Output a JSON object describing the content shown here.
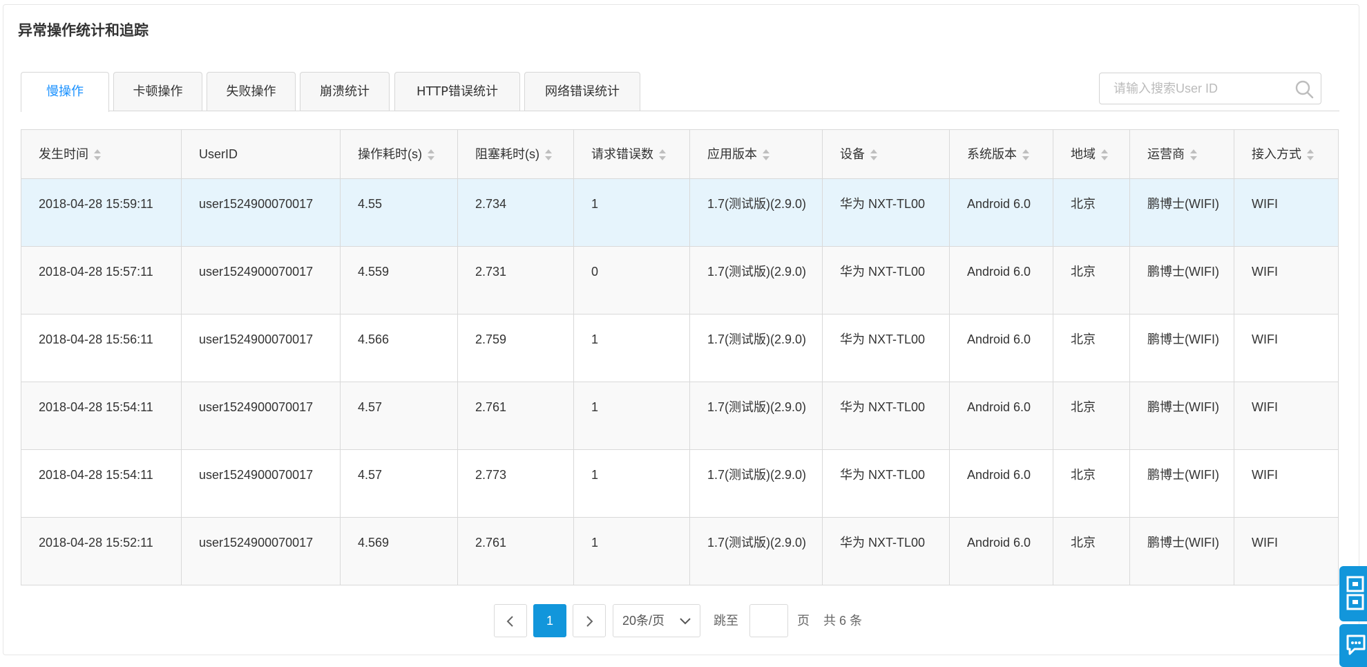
{
  "page": {
    "title": "异常操作统计和追踪"
  },
  "tabs": [
    {
      "label": "慢操作",
      "active": true
    },
    {
      "label": "卡顿操作",
      "active": false
    },
    {
      "label": "失败操作",
      "active": false
    },
    {
      "label": "崩溃统计",
      "active": false
    },
    {
      "label": "HTTP错误统计",
      "active": false
    },
    {
      "label": "网络错误统计",
      "active": false
    }
  ],
  "search": {
    "placeholder": "请输入搜索User ID",
    "value": "",
    "icon": "search-icon"
  },
  "table": {
    "columns": [
      "发生时间",
      "UserID",
      "操作耗时(s)",
      "阻塞耗时(s)",
      "请求错误数",
      "应用版本",
      "设备",
      "系统版本",
      "地域",
      "运营商",
      "接入方式"
    ],
    "rows": [
      [
        "2018-04-28 15:59:11",
        "user1524900070017",
        "4.55",
        "2.734",
        "1",
        "1.7(测试版)(2.9.0)",
        "华为 NXT-TL00",
        "Android 6.0",
        "北京",
        "鹏博士(WIFI)",
        "WIFI"
      ],
      [
        "2018-04-28 15:57:11",
        "user1524900070017",
        "4.559",
        "2.731",
        "0",
        "1.7(测试版)(2.9.0)",
        "华为 NXT-TL00",
        "Android 6.0",
        "北京",
        "鹏博士(WIFI)",
        "WIFI"
      ],
      [
        "2018-04-28 15:56:11",
        "user1524900070017",
        "4.566",
        "2.759",
        "1",
        "1.7(测试版)(2.9.0)",
        "华为 NXT-TL00",
        "Android 6.0",
        "北京",
        "鹏博士(WIFI)",
        "WIFI"
      ],
      [
        "2018-04-28 15:54:11",
        "user1524900070017",
        "4.57",
        "2.761",
        "1",
        "1.7(测试版)(2.9.0)",
        "华为 NXT-TL00",
        "Android 6.0",
        "北京",
        "鹏博士(WIFI)",
        "WIFI"
      ],
      [
        "2018-04-28 15:54:11",
        "user1524900070017",
        "4.57",
        "2.773",
        "1",
        "1.7(测试版)(2.9.0)",
        "华为 NXT-TL00",
        "Android 6.0",
        "北京",
        "鹏博士(WIFI)",
        "WIFI"
      ],
      [
        "2018-04-28 15:52:11",
        "user1524900070017",
        "4.569",
        "2.761",
        "1",
        "1.7(测试版)(2.9.0)",
        "华为 NXT-TL00",
        "Android 6.0",
        "北京",
        "鹏博士(WIFI)",
        "WIFI"
      ]
    ],
    "selected_row": 0
  },
  "pagination": {
    "prev_icon": "chevron-left-icon",
    "current_page": "1",
    "next_icon": "chevron-right-icon",
    "page_size": "20条/页",
    "page_size_icon": "chevron-down-icon",
    "jump_label": "跳至",
    "jump_value": "",
    "page_unit": "页",
    "total": "共 6 条"
  },
  "side_buttons": [
    "qrcode-icon",
    "chat-icon"
  ],
  "colors": {
    "accent": "#1296db",
    "tab_active_text": "#1890ff",
    "selected_row": "#e6f4fc",
    "border": "#d9d9d9"
  }
}
